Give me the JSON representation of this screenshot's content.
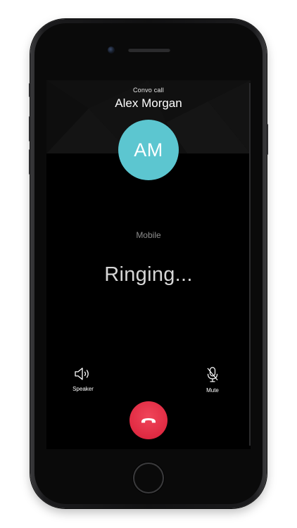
{
  "call": {
    "type_label": "Convo call",
    "contact_name": "Alex Morgan",
    "avatar_initials": "AM",
    "phone_type": "Mobile",
    "status": "Ringing..."
  },
  "controls": {
    "speaker_label": "Speaker",
    "mute_label": "Mute",
    "speaker_icon": "speaker-icon",
    "mute_icon": "microphone-muted-icon",
    "end_call_icon": "hang-up-icon"
  },
  "colors": {
    "avatar": "#5cc6d0",
    "end_call": "#e02a42",
    "screen_background": "#000000"
  }
}
